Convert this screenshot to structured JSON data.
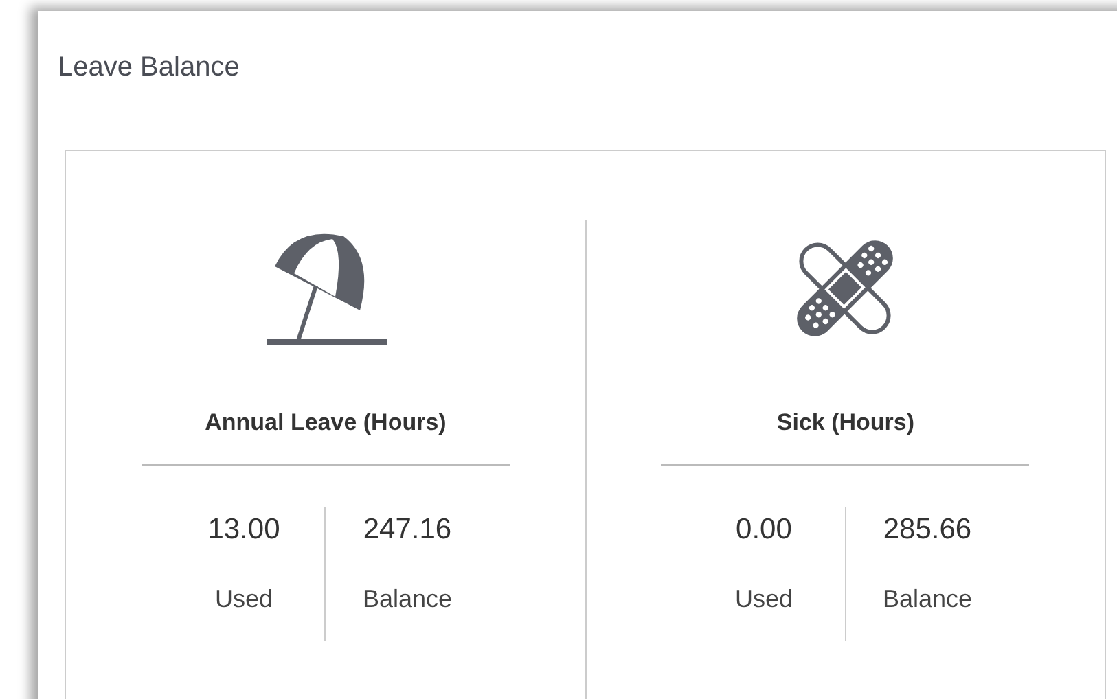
{
  "title": "Leave Balance",
  "categories": [
    {
      "kind": "beach",
      "name": "Annual Leave (Hours)",
      "stats": [
        {
          "value": "13.00",
          "label": "Used"
        },
        {
          "value": "247.16",
          "label": "Balance"
        }
      ]
    },
    {
      "kind": "sick",
      "name": "Sick (Hours)",
      "stats": [
        {
          "value": "0.00",
          "label": "Used"
        },
        {
          "value": "285.66",
          "label": "Balance"
        }
      ]
    }
  ]
}
